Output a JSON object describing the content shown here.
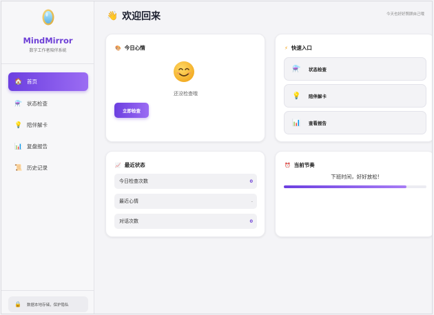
{
  "brand": {
    "title": "MindMirror",
    "subtitle": "数字工作者陪伴系统"
  },
  "nav": [
    {
      "label": "首页",
      "icon": "house-icon",
      "active": true
    },
    {
      "label": "状态检查",
      "icon": "flask-icon",
      "active": false
    },
    {
      "label": "陪伴解卡",
      "icon": "lightbulb-icon",
      "active": false
    },
    {
      "label": "复盘报告",
      "icon": "bar-chart-icon",
      "active": false
    },
    {
      "label": "历史记录",
      "icon": "scroll-icon",
      "active": false
    }
  ],
  "footer": {
    "label": "数据本地存储，保护隐私",
    "icon": "lock-icon"
  },
  "header": {
    "title": "欢迎回来",
    "icon": "waving-hand-icon",
    "note": "今天也好好照顾自己哦"
  },
  "mood_card": {
    "title": "今日心情",
    "icon": "palette-icon",
    "emoji": "smiling-face-icon",
    "empty_text": "还没检查哦",
    "button_label": "立即检查"
  },
  "quick_card": {
    "title": "快速入口",
    "icon": "lightning-icon",
    "items": [
      {
        "label": "状态检查",
        "icon": "flask-icon"
      },
      {
        "label": "陪伴解卡",
        "icon": "lightbulb-icon"
      },
      {
        "label": "查看报告",
        "icon": "bar-chart-icon"
      }
    ]
  },
  "status_card": {
    "title": "最近状态",
    "icon": "chart-icon",
    "rows": [
      {
        "label": "今日检查次数",
        "value": "0"
      },
      {
        "label": "最近心情",
        "value": "-"
      },
      {
        "label": "对话次数",
        "value": "0"
      }
    ]
  },
  "rhythm_card": {
    "title": "当前节奏",
    "icon": "alarm-clock-icon",
    "text": "下班时间，好好放松!",
    "progress": 0.86
  },
  "colors": {
    "accent": "#6d3fd6",
    "accent_light": "#9b6cf3"
  }
}
